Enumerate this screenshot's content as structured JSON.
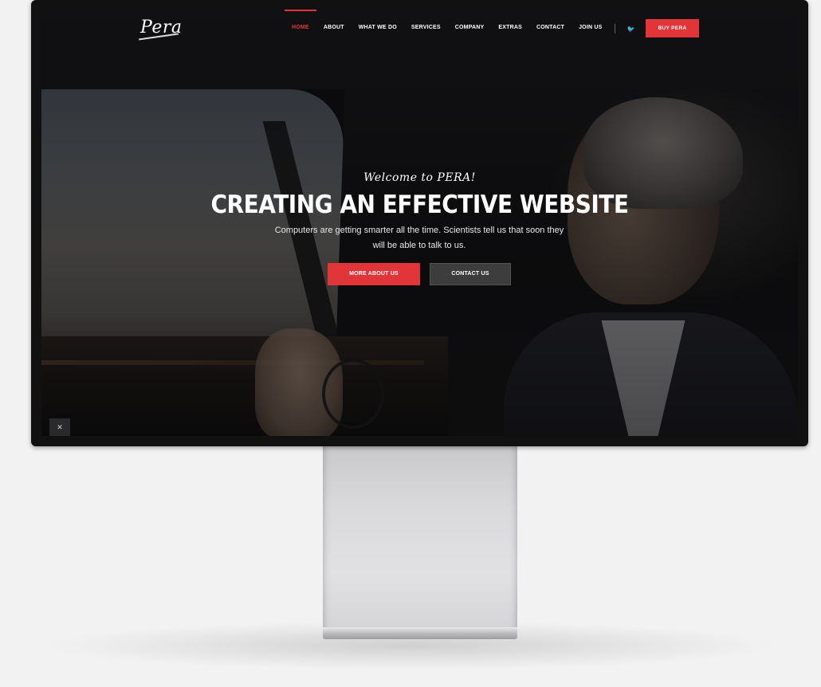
{
  "logo": "Pera",
  "nav": {
    "items": [
      {
        "label": "HOME",
        "active": true
      },
      {
        "label": "ABOUT",
        "active": false
      },
      {
        "label": "WHAT WE DO",
        "active": false
      },
      {
        "label": "SERVICES",
        "active": false
      },
      {
        "label": "COMPANY",
        "active": false
      },
      {
        "label": "EXTRAS",
        "active": false
      },
      {
        "label": "CONTACT",
        "active": false
      },
      {
        "label": "JOIN US",
        "active": false
      }
    ],
    "social": [
      {
        "icon": "twitter-icon",
        "glyph": "🐦"
      },
      {
        "icon": "instagram-icon",
        "glyph": "◎"
      }
    ],
    "buy_label": "BUY PERA"
  },
  "hero": {
    "welcome": "Welcome to PERA!",
    "title": "CREATING AN EFFECTIVE WEBSITE",
    "text": "Computers are getting smarter all the time. Scientists tell us that soon they will be able to talk to us.",
    "primary_button": "MORE ABOUT US",
    "secondary_button": "CONTACT US"
  },
  "corner_button_glyph": "✕",
  "colors": {
    "accent": "#e1353a",
    "background": "#f2f2f2",
    "bezel": "#111111",
    "secondary_button": "#464648"
  }
}
